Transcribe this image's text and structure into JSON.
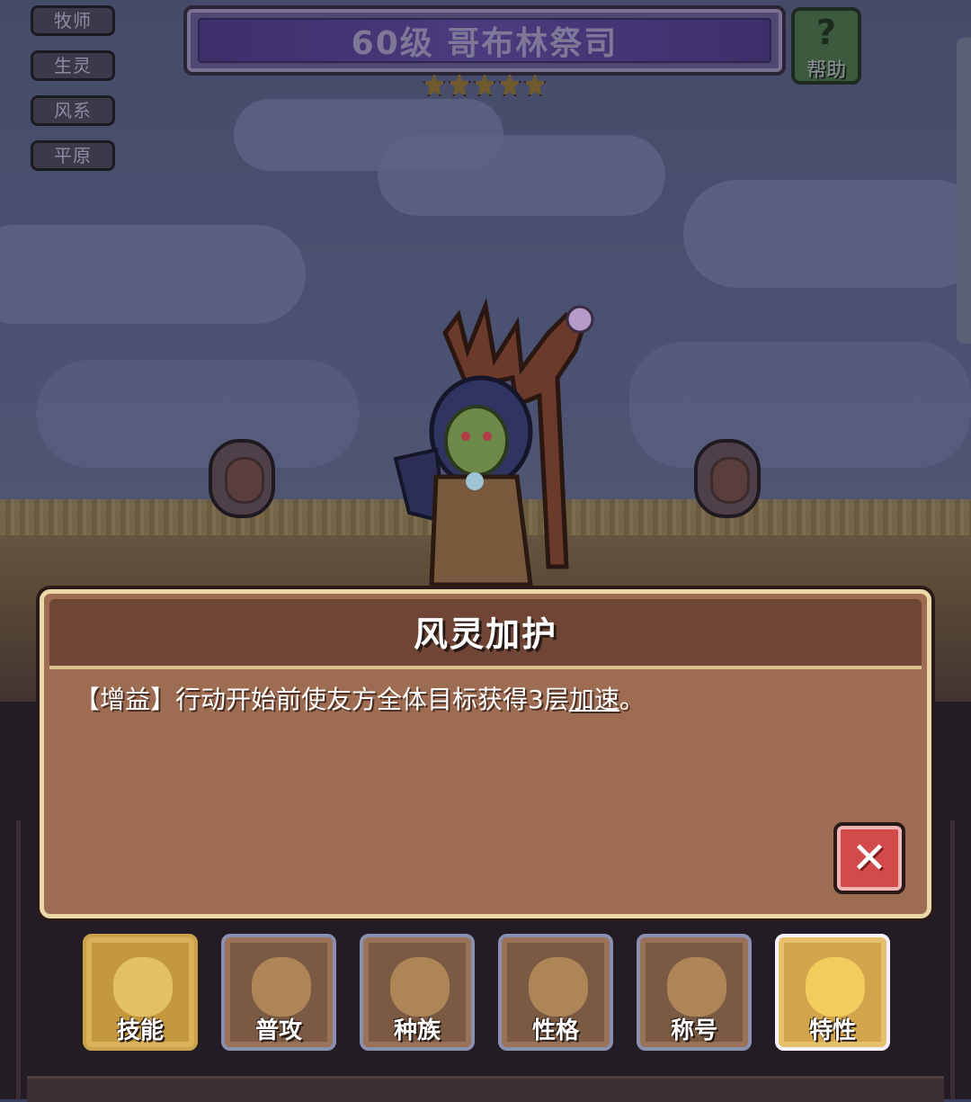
{
  "tags": [
    "牧师",
    "生灵",
    "风系",
    "平原"
  ],
  "header": {
    "title": "60级 哥布林祭司",
    "star_count": 5,
    "help_label": "帮助"
  },
  "dialog": {
    "title": "风灵加护",
    "description_prefix": "【增益】行动开始前使友方全体目标获得3层",
    "description_keyword": "加速",
    "description_suffix": "。"
  },
  "tabs": [
    {
      "label": "技能"
    },
    {
      "label": "普攻"
    },
    {
      "label": "种族"
    },
    {
      "label": "性格"
    },
    {
      "label": "称号"
    },
    {
      "label": "特性"
    }
  ],
  "colors": {
    "dialog_bg": "#9e6c52",
    "dialog_border": "#ecd7a6",
    "active_tab": "#d2a54c",
    "close_button": "#d34a4a"
  }
}
